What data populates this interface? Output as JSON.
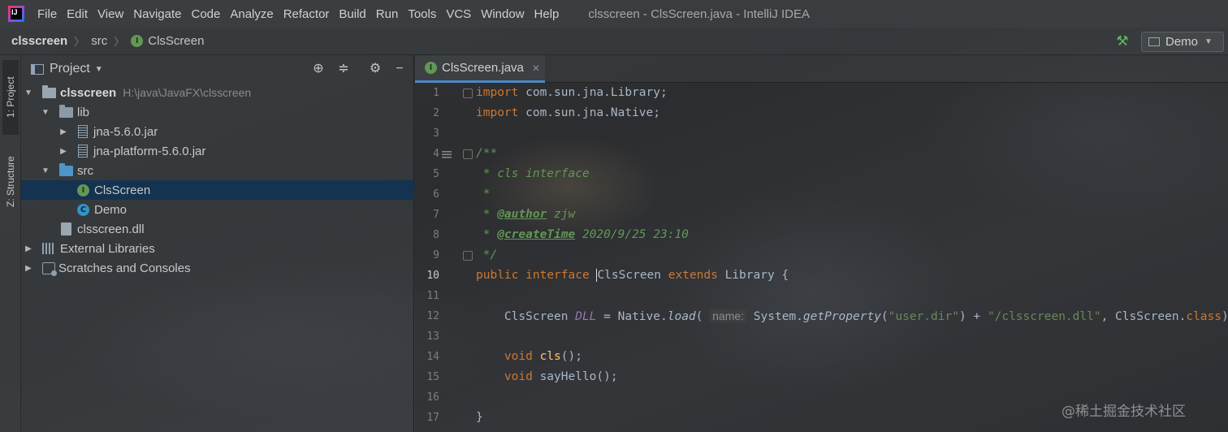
{
  "menubar": {
    "logo_text": "IJ",
    "items": [
      {
        "label": "File"
      },
      {
        "label": "Edit"
      },
      {
        "label": "View"
      },
      {
        "label": "Navigate"
      },
      {
        "label": "Code"
      },
      {
        "label": "Analyze"
      },
      {
        "label": "Refactor"
      },
      {
        "label": "Build"
      },
      {
        "label": "Run"
      },
      {
        "label": "Tools"
      },
      {
        "label": "VCS"
      },
      {
        "label": "Window"
      },
      {
        "label": "Help"
      }
    ],
    "window_title": "clsscreen - ClsScreen.java - IntelliJ IDEA"
  },
  "navbar": {
    "project": "clsscreen",
    "folder": "src",
    "file": "ClsScreen",
    "run_config": "Demo",
    "icons": {
      "build": "hammer-icon",
      "interface": "interface-icon"
    }
  },
  "left_stripe": {
    "project_tab": "1: Project",
    "structure_tab": "Z: Structure"
  },
  "project_panel": {
    "title": "Project",
    "tree": [
      {
        "label": "clsscreen",
        "hint": "H:\\java\\JavaFX\\clsscreen"
      },
      {
        "label": "lib"
      },
      {
        "label": "jna-5.6.0.jar"
      },
      {
        "label": "jna-platform-5.6.0.jar"
      },
      {
        "label": "src"
      },
      {
        "label": "ClsScreen",
        "selected": true
      },
      {
        "label": "Demo"
      },
      {
        "label": "clsscreen.dll"
      },
      {
        "label": "External Libraries"
      },
      {
        "label": "Scratches and Consoles"
      }
    ]
  },
  "editor": {
    "tab_label": "ClsScreen.java",
    "current_line": 10,
    "line_numbers": [
      "1",
      "2",
      "3",
      "4",
      "5",
      "6",
      "7",
      "8",
      "9",
      "10",
      "11",
      "12",
      "13",
      "14",
      "15",
      "16",
      "17"
    ],
    "code": {
      "l1_kw": "import",
      "l1_rest": " com.sun.jna.Library;",
      "l2_kw": "import",
      "l2_rest": " com.sun.jna.Native;",
      "l4": "/**",
      "l5": " * cls interface",
      "l6": " *",
      "l7_pre": " * ",
      "l7_tag": "@author",
      "l7_val": " zjw",
      "l8_pre": " * ",
      "l8_tag": "@createTime",
      "l8_val": " 2020/9/25 23:10",
      "l9": " */",
      "l10_kw1": "public",
      "l10_kw2": "interface",
      "l10_name": "ClsScreen",
      "l10_kw3": "extends",
      "l10_rest": " Library {",
      "l12_type": "    ClsScreen ",
      "l12_field": "DLL",
      "l12_eq": " = Native.",
      "l12_load": "load",
      "l12_paren": "(",
      "l12_hint": "name:",
      "l12_sys": " System.",
      "l12_getprop": "getProperty",
      "l12_open": "(",
      "l12_str1": "\"user.dir\"",
      "l12_plus": ") + ",
      "l12_str2": "\"/clsscreen.dll\"",
      "l12_comma": ", ClsScreen.",
      "l12_class": "class",
      "l12_end": ");",
      "l14_kw": "    void",
      "l14_fn": " cls",
      "l14_end": "();",
      "l15_kw": "    void",
      "l15_rest": " sayHello();",
      "l17": "}"
    }
  },
  "watermark": "@稀土掘金技术社区"
}
